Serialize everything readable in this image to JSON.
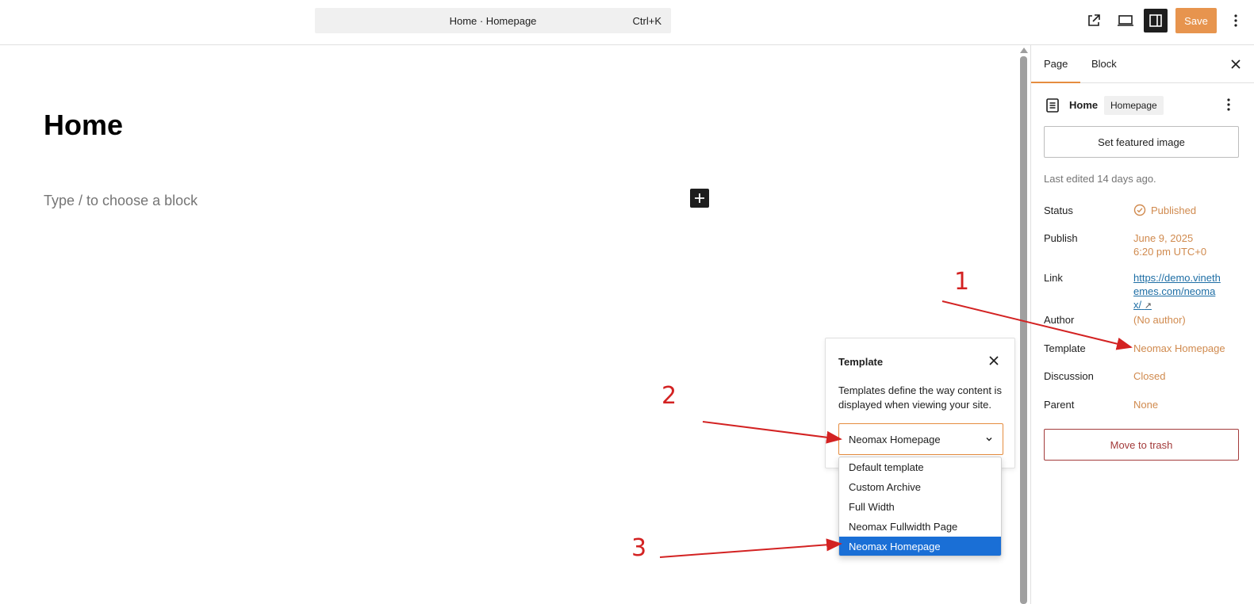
{
  "topbar": {
    "doc_title": "Home · Homepage",
    "shortcut": "Ctrl+K",
    "save_label": "Save",
    "icons": [
      "external-link-icon",
      "desktop-preview-icon",
      "sidebar-toggle-icon",
      "more-vertical-icon"
    ]
  },
  "canvas": {
    "title": "Home",
    "block_placeholder": "Type / to choose a block"
  },
  "sidebar": {
    "tabs": [
      "Page",
      "Block"
    ],
    "summary": {
      "title": "Home",
      "badge": "Homepage"
    },
    "featured_image_label": "Set featured image",
    "last_edited": "Last edited 14 days ago.",
    "rows": {
      "status": {
        "label": "Status",
        "value": "Published"
      },
      "publish": {
        "label": "Publish",
        "date": "June 9, 2025",
        "time": "6:20 pm UTC+0"
      },
      "link": {
        "label": "Link",
        "value": "https://demo.vinethemes.com/neomax/",
        "arrow": "↗"
      },
      "author": {
        "label": "Author",
        "value": "(No author)"
      },
      "template": {
        "label": "Template",
        "value": "Neomax Homepage"
      },
      "discussion": {
        "label": "Discussion",
        "value": "Closed"
      },
      "parent": {
        "label": "Parent",
        "value": "None"
      }
    },
    "trash_label": "Move to trash"
  },
  "template_popover": {
    "title": "Template",
    "description": "Templates define the way content is displayed when viewing your site.",
    "selected": "Neomax Homepage",
    "options": [
      "Default template",
      "Custom Archive",
      "Full Width",
      "Neomax Fullwidth Page",
      "Neomax Homepage"
    ]
  },
  "annotations": {
    "one": "1",
    "two": "2",
    "three": "3",
    "color": "#d32222"
  },
  "colors": {
    "accent": "#e58c3f",
    "selected_option": "#1a6fd6",
    "danger": "#a33b3b"
  }
}
